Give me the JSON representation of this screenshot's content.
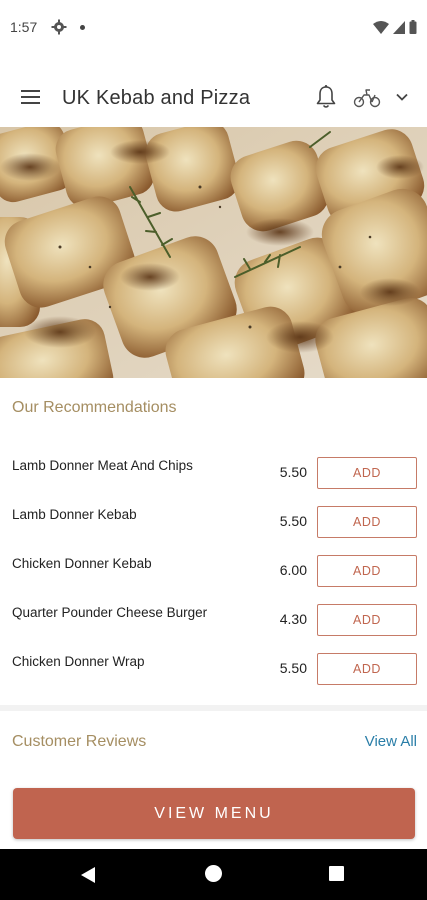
{
  "status_bar": {
    "time": "1:57"
  },
  "app_bar": {
    "title": "UK Kebab and Pizza"
  },
  "recommendations": {
    "title": "Our Recommendations",
    "add_label": "ADD",
    "items": [
      {
        "name": "Lamb Donner Meat And Chips",
        "price": "5.50"
      },
      {
        "name": "Lamb Donner Kebab",
        "price": "5.50"
      },
      {
        "name": "Chicken Donner Kebab",
        "price": "6.00"
      },
      {
        "name": "Quarter Pounder Cheese Burger",
        "price": "4.30"
      },
      {
        "name": "Chicken Donner Wrap",
        "price": "5.50"
      }
    ]
  },
  "reviews": {
    "title": "Customer Reviews",
    "view_all": "View All"
  },
  "cta": {
    "label": "VIEW MENU"
  },
  "colors": {
    "accent": "#c0644f",
    "section_title": "#a58e62",
    "link": "#2a7ea8"
  },
  "icons": [
    "settings-icon",
    "wifi-icon",
    "signal-icon",
    "battery-icon",
    "menu-icon",
    "bell-icon",
    "scooter-icon",
    "chevron-down-icon",
    "back-icon",
    "home-icon",
    "recents-icon"
  ]
}
